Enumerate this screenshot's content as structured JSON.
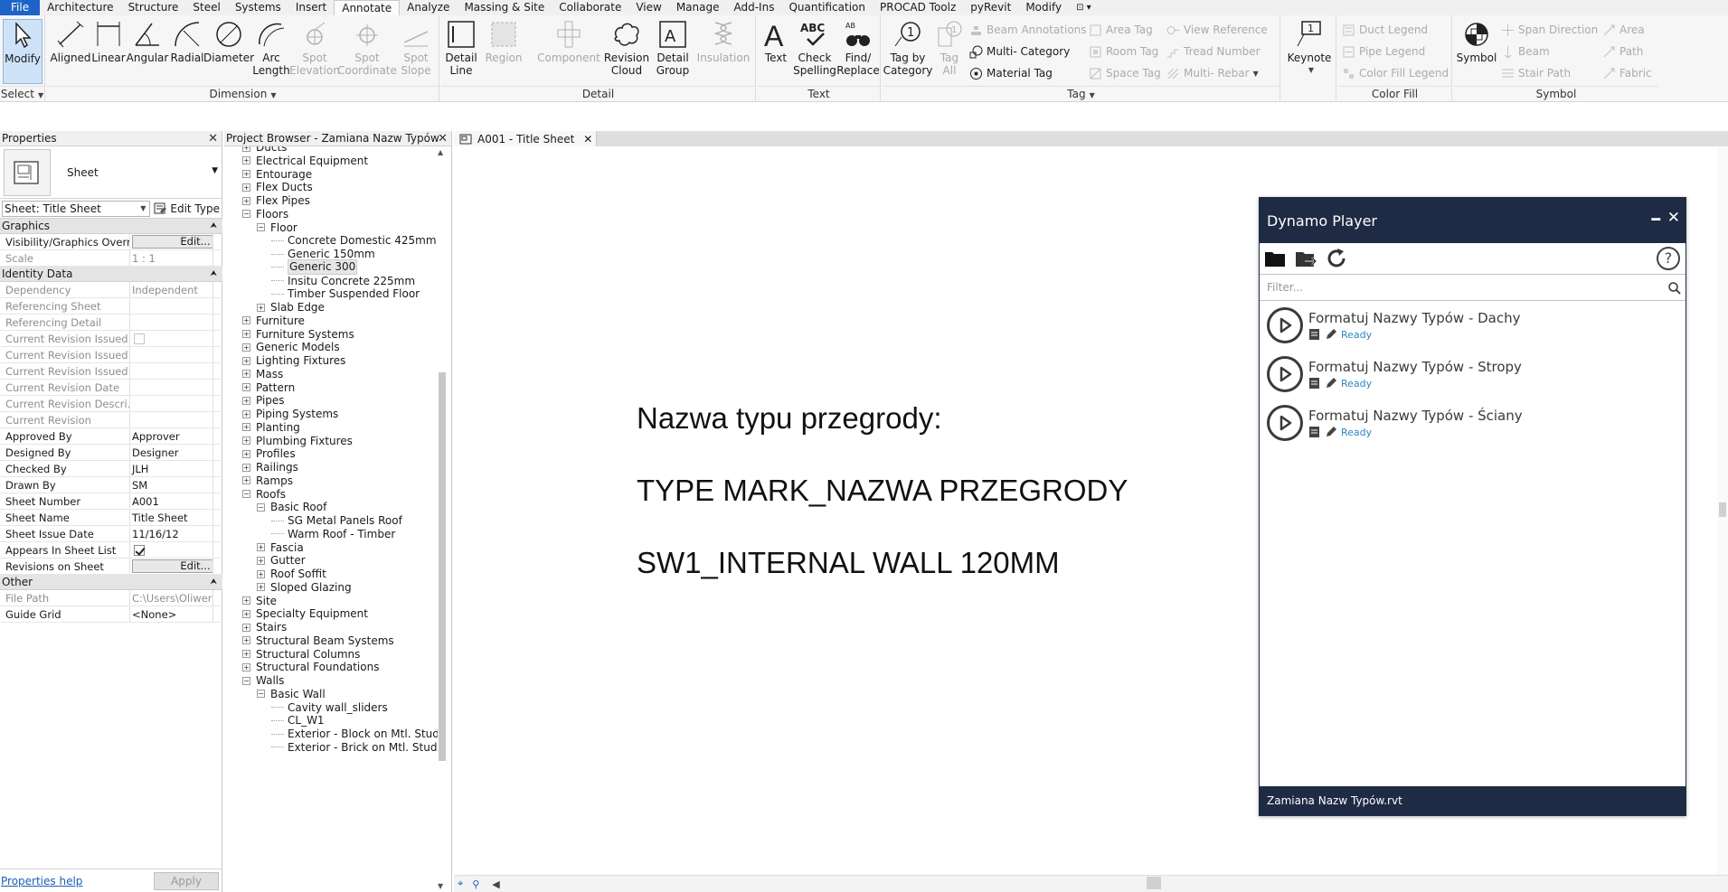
{
  "menu": {
    "tabs": [
      {
        "label": "File"
      },
      {
        "label": "Architecture"
      },
      {
        "label": "Structure"
      },
      {
        "label": "Steel"
      },
      {
        "label": "Systems"
      },
      {
        "label": "Insert"
      },
      {
        "label": "Annotate"
      },
      {
        "label": "Analyze"
      },
      {
        "label": "Massing & Site"
      },
      {
        "label": "Collaborate"
      },
      {
        "label": "View"
      },
      {
        "label": "Manage"
      },
      {
        "label": "Add-Ins"
      },
      {
        "label": "Quantification"
      },
      {
        "label": "PROCAD Toolz"
      },
      {
        "label": "pyRevit"
      },
      {
        "label": "Modify"
      },
      {
        "label": "⊡ ▾"
      }
    ],
    "active_tab": "Annotate"
  },
  "ribbon": {
    "select": {
      "title": "Select",
      "modify": "Modify"
    },
    "dimension": {
      "title": "Dimension",
      "aligned": "Aligned",
      "linear": "Linear",
      "angular": "Angular",
      "radial": "Radial",
      "diameter": "Diameter",
      "arc_length_1": "Arc",
      "arc_length_2": "Length",
      "spot_elev_1": "Spot",
      "spot_elev_2": "Elevation",
      "spot_coord_1": "Spot",
      "spot_coord_2": "Coordinate",
      "spot_slope_1": "Spot",
      "spot_slope_2": "Slope"
    },
    "detail": {
      "title": "Detail",
      "detail_line_1": "Detail",
      "detail_line_2": "Line",
      "region": "Region",
      "component": "Component",
      "revision_cloud_1": "Revision",
      "revision_cloud_2": "Cloud",
      "detail_group_1": "Detail",
      "detail_group_2": "Group",
      "insulation": "Insulation"
    },
    "text": {
      "title": "Text",
      "text": "Text",
      "check_spelling_1": "Check",
      "check_spelling_2": "Spelling",
      "find_replace_1": "Find/",
      "find_replace_2": "Replace"
    },
    "tag": {
      "title": "Tag",
      "tag_by_category_1": "Tag by",
      "tag_by_category_2": "Category",
      "tag_all_1": "Tag",
      "tag_all_2": "All",
      "beam_annotations": "Beam  Annotations",
      "multi_category": "Multi- Category",
      "material_tag": "Material  Tag",
      "area_tag": "Area  Tag",
      "room_tag": "Room  Tag",
      "space_tag": "Space  Tag",
      "view_reference": "View  Reference",
      "tread_number": "Tread  Number",
      "multi_rebar": "Multi- Rebar"
    },
    "keynote": {
      "label": "Keynote"
    },
    "color_fill": {
      "title": "Color Fill",
      "duct_legend": "Duct  Legend",
      "pipe_legend": "Pipe  Legend",
      "color_fill_legend": "Color Fill  Legend"
    },
    "symbol": {
      "title": "Symbol",
      "symbol": "Symbol",
      "span_direction": "Span  Direction",
      "beam": "Beam",
      "stair_path": "Stair  Path",
      "area": "Area",
      "path": "Path",
      "fabric": "Fabric"
    }
  },
  "properties": {
    "title": "Properties",
    "type_name": "Sheet",
    "instance_selector": "Sheet: Title Sheet",
    "edit_type": "Edit Type",
    "groups": [
      {
        "name": "Graphics",
        "rows": [
          {
            "name": "Visibility/Graphics Overr...",
            "value": "Edit...",
            "kind": "button"
          },
          {
            "name": "Scale",
            "value": "1 : 1",
            "kind": "readonly"
          }
        ]
      },
      {
        "name": "Identity Data",
        "rows": [
          {
            "name": "Dependency",
            "value": "Independent",
            "kind": "readonly"
          },
          {
            "name": "Referencing Sheet",
            "value": "",
            "kind": "readonly"
          },
          {
            "name": "Referencing Detail",
            "value": "",
            "kind": "readonly"
          },
          {
            "name": "Current Revision Issued",
            "value": "",
            "kind": "checkbox-off"
          },
          {
            "name": "Current Revision Issued ...",
            "value": "",
            "kind": "readonly"
          },
          {
            "name": "Current Revision Issued ...",
            "value": "",
            "kind": "readonly"
          },
          {
            "name": "Current Revision Date",
            "value": "",
            "kind": "readonly"
          },
          {
            "name": "Current Revision Descri...",
            "value": "",
            "kind": "readonly"
          },
          {
            "name": "Current Revision",
            "value": "",
            "kind": "readonly"
          },
          {
            "name": "Approved By",
            "value": "Approver",
            "kind": "text"
          },
          {
            "name": "Designed By",
            "value": "Designer",
            "kind": "text"
          },
          {
            "name": "Checked By",
            "value": "JLH",
            "kind": "text"
          },
          {
            "name": "Drawn By",
            "value": "SM",
            "kind": "text"
          },
          {
            "name": "Sheet Number",
            "value": "A001",
            "kind": "text"
          },
          {
            "name": "Sheet Name",
            "value": "Title Sheet",
            "kind": "text"
          },
          {
            "name": "Sheet Issue Date",
            "value": "11/16/12",
            "kind": "text"
          },
          {
            "name": "Appears In Sheet List",
            "value": "",
            "kind": "checkbox-on"
          },
          {
            "name": "Revisions on Sheet",
            "value": "Edit...",
            "kind": "button"
          }
        ]
      },
      {
        "name": "Other",
        "rows": [
          {
            "name": "File Path",
            "value": "C:\\Users\\Oliwer Kulpa\\D...",
            "kind": "readonly"
          },
          {
            "name": "Guide Grid",
            "value": "<None>",
            "kind": "text"
          }
        ]
      }
    ],
    "help": "Properties help",
    "apply": "Apply"
  },
  "project_browser": {
    "title": "Project Browser - Zamiana Nazw Typów",
    "nodes": [
      {
        "label": "Ducts",
        "level": 0,
        "toggle": "+"
      },
      {
        "label": "Electrical Equipment",
        "level": 0,
        "toggle": "+"
      },
      {
        "label": "Entourage",
        "level": 0,
        "toggle": "+"
      },
      {
        "label": "Flex Ducts",
        "level": 0,
        "toggle": "+"
      },
      {
        "label": "Flex Pipes",
        "level": 0,
        "toggle": "+"
      },
      {
        "label": "Floors",
        "level": 0,
        "toggle": "-"
      },
      {
        "label": "Floor",
        "level": 1,
        "toggle": "-"
      },
      {
        "label": "Concrete Domestic 425mm",
        "level": 2,
        "toggle": ""
      },
      {
        "label": "Generic 150mm",
        "level": 2,
        "toggle": ""
      },
      {
        "label": "Generic 300",
        "level": 2,
        "toggle": "",
        "highlight": true
      },
      {
        "label": "Insitu Concrete 225mm",
        "level": 2,
        "toggle": ""
      },
      {
        "label": "Timber Suspended Floor",
        "level": 2,
        "toggle": ""
      },
      {
        "label": "Slab Edge",
        "level": 1,
        "toggle": "+"
      },
      {
        "label": "Furniture",
        "level": 0,
        "toggle": "+"
      },
      {
        "label": "Furniture Systems",
        "level": 0,
        "toggle": "+"
      },
      {
        "label": "Generic Models",
        "level": 0,
        "toggle": "+"
      },
      {
        "label": "Lighting Fixtures",
        "level": 0,
        "toggle": "+"
      },
      {
        "label": "Mass",
        "level": 0,
        "toggle": "+"
      },
      {
        "label": "Pattern",
        "level": 0,
        "toggle": "+"
      },
      {
        "label": "Pipes",
        "level": 0,
        "toggle": "+"
      },
      {
        "label": "Piping Systems",
        "level": 0,
        "toggle": "+"
      },
      {
        "label": "Planting",
        "level": 0,
        "toggle": "+"
      },
      {
        "label": "Plumbing Fixtures",
        "level": 0,
        "toggle": "+"
      },
      {
        "label": "Profiles",
        "level": 0,
        "toggle": "+"
      },
      {
        "label": "Railings",
        "level": 0,
        "toggle": "+"
      },
      {
        "label": "Ramps",
        "level": 0,
        "toggle": "+"
      },
      {
        "label": "Roofs",
        "level": 0,
        "toggle": "-"
      },
      {
        "label": "Basic Roof",
        "level": 1,
        "toggle": "-"
      },
      {
        "label": "SG Metal Panels Roof",
        "level": 2,
        "toggle": ""
      },
      {
        "label": "Warm Roof - Timber",
        "level": 2,
        "toggle": ""
      },
      {
        "label": "Fascia",
        "level": 1,
        "toggle": "+"
      },
      {
        "label": "Gutter",
        "level": 1,
        "toggle": "+"
      },
      {
        "label": "Roof Soffit",
        "level": 1,
        "toggle": "+"
      },
      {
        "label": "Sloped Glazing",
        "level": 1,
        "toggle": "+"
      },
      {
        "label": "Site",
        "level": 0,
        "toggle": "+"
      },
      {
        "label": "Specialty Equipment",
        "level": 0,
        "toggle": "+"
      },
      {
        "label": "Stairs",
        "level": 0,
        "toggle": "+"
      },
      {
        "label": "Structural Beam Systems",
        "level": 0,
        "toggle": "+"
      },
      {
        "label": "Structural Columns",
        "level": 0,
        "toggle": "+"
      },
      {
        "label": "Structural Foundations",
        "level": 0,
        "toggle": "+"
      },
      {
        "label": "Walls",
        "level": 0,
        "toggle": "-"
      },
      {
        "label": "Basic Wall",
        "level": 1,
        "toggle": "-"
      },
      {
        "label": "Cavity wall_sliders",
        "level": 2,
        "toggle": ""
      },
      {
        "label": "CL_W1",
        "level": 2,
        "toggle": ""
      },
      {
        "label": "Exterior - Block on Mtl. Stud",
        "level": 2,
        "toggle": ""
      },
      {
        "label": "Exterior - Brick on Mtl. Stud",
        "level": 2,
        "toggle": ""
      }
    ]
  },
  "view": {
    "tab_label": "A001 - Title Sheet",
    "lines": [
      "Nazwa typu przegrody:",
      "TYPE MARK_NAZWA PRZEGRODY",
      "SW1_INTERNAL WALL 120MM"
    ]
  },
  "dynamo": {
    "title": "Dynamo Player",
    "filter_placeholder": "Filter...",
    "scripts": [
      {
        "name": "Formatuj Nazwy Typów - Dachy",
        "status": "Ready"
      },
      {
        "name": "Formatuj Nazwy Typów - Stropy",
        "status": "Ready"
      },
      {
        "name": "Formatuj Nazwy Typów - Ściany",
        "status": "Ready"
      }
    ],
    "footer": "Zamiana Nazw Typów.rvt"
  }
}
